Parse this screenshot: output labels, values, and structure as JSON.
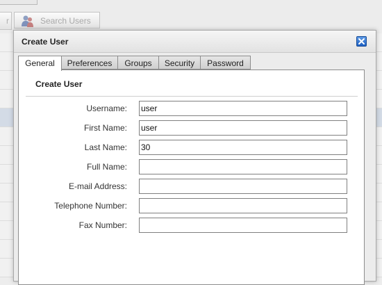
{
  "background": {
    "search_users_label": "Search Users",
    "partial_button_label": "r"
  },
  "dialog": {
    "title": "Create User",
    "tabs": [
      {
        "label": "General",
        "active": true
      },
      {
        "label": "Preferences",
        "active": false
      },
      {
        "label": "Groups",
        "active": false
      },
      {
        "label": "Security",
        "active": false
      },
      {
        "label": "Password",
        "active": false
      }
    ],
    "section_title": "Create User",
    "required_marker": "*",
    "fields": [
      {
        "label": "Username:",
        "value": "user",
        "required": true
      },
      {
        "label": "First Name:",
        "value": "user",
        "required": true
      },
      {
        "label": "Last Name:",
        "value": "30",
        "required": true
      },
      {
        "label": "Full Name:",
        "value": "",
        "required": false
      },
      {
        "label": "E-mail Address:",
        "value": "",
        "required": false
      },
      {
        "label": "Telephone Number:",
        "value": "",
        "required": false
      },
      {
        "label": "Fax Number:",
        "value": "",
        "required": false
      }
    ]
  },
  "colors": {
    "close_button": "#2a6fd0",
    "required_marker": "#c0392b"
  }
}
